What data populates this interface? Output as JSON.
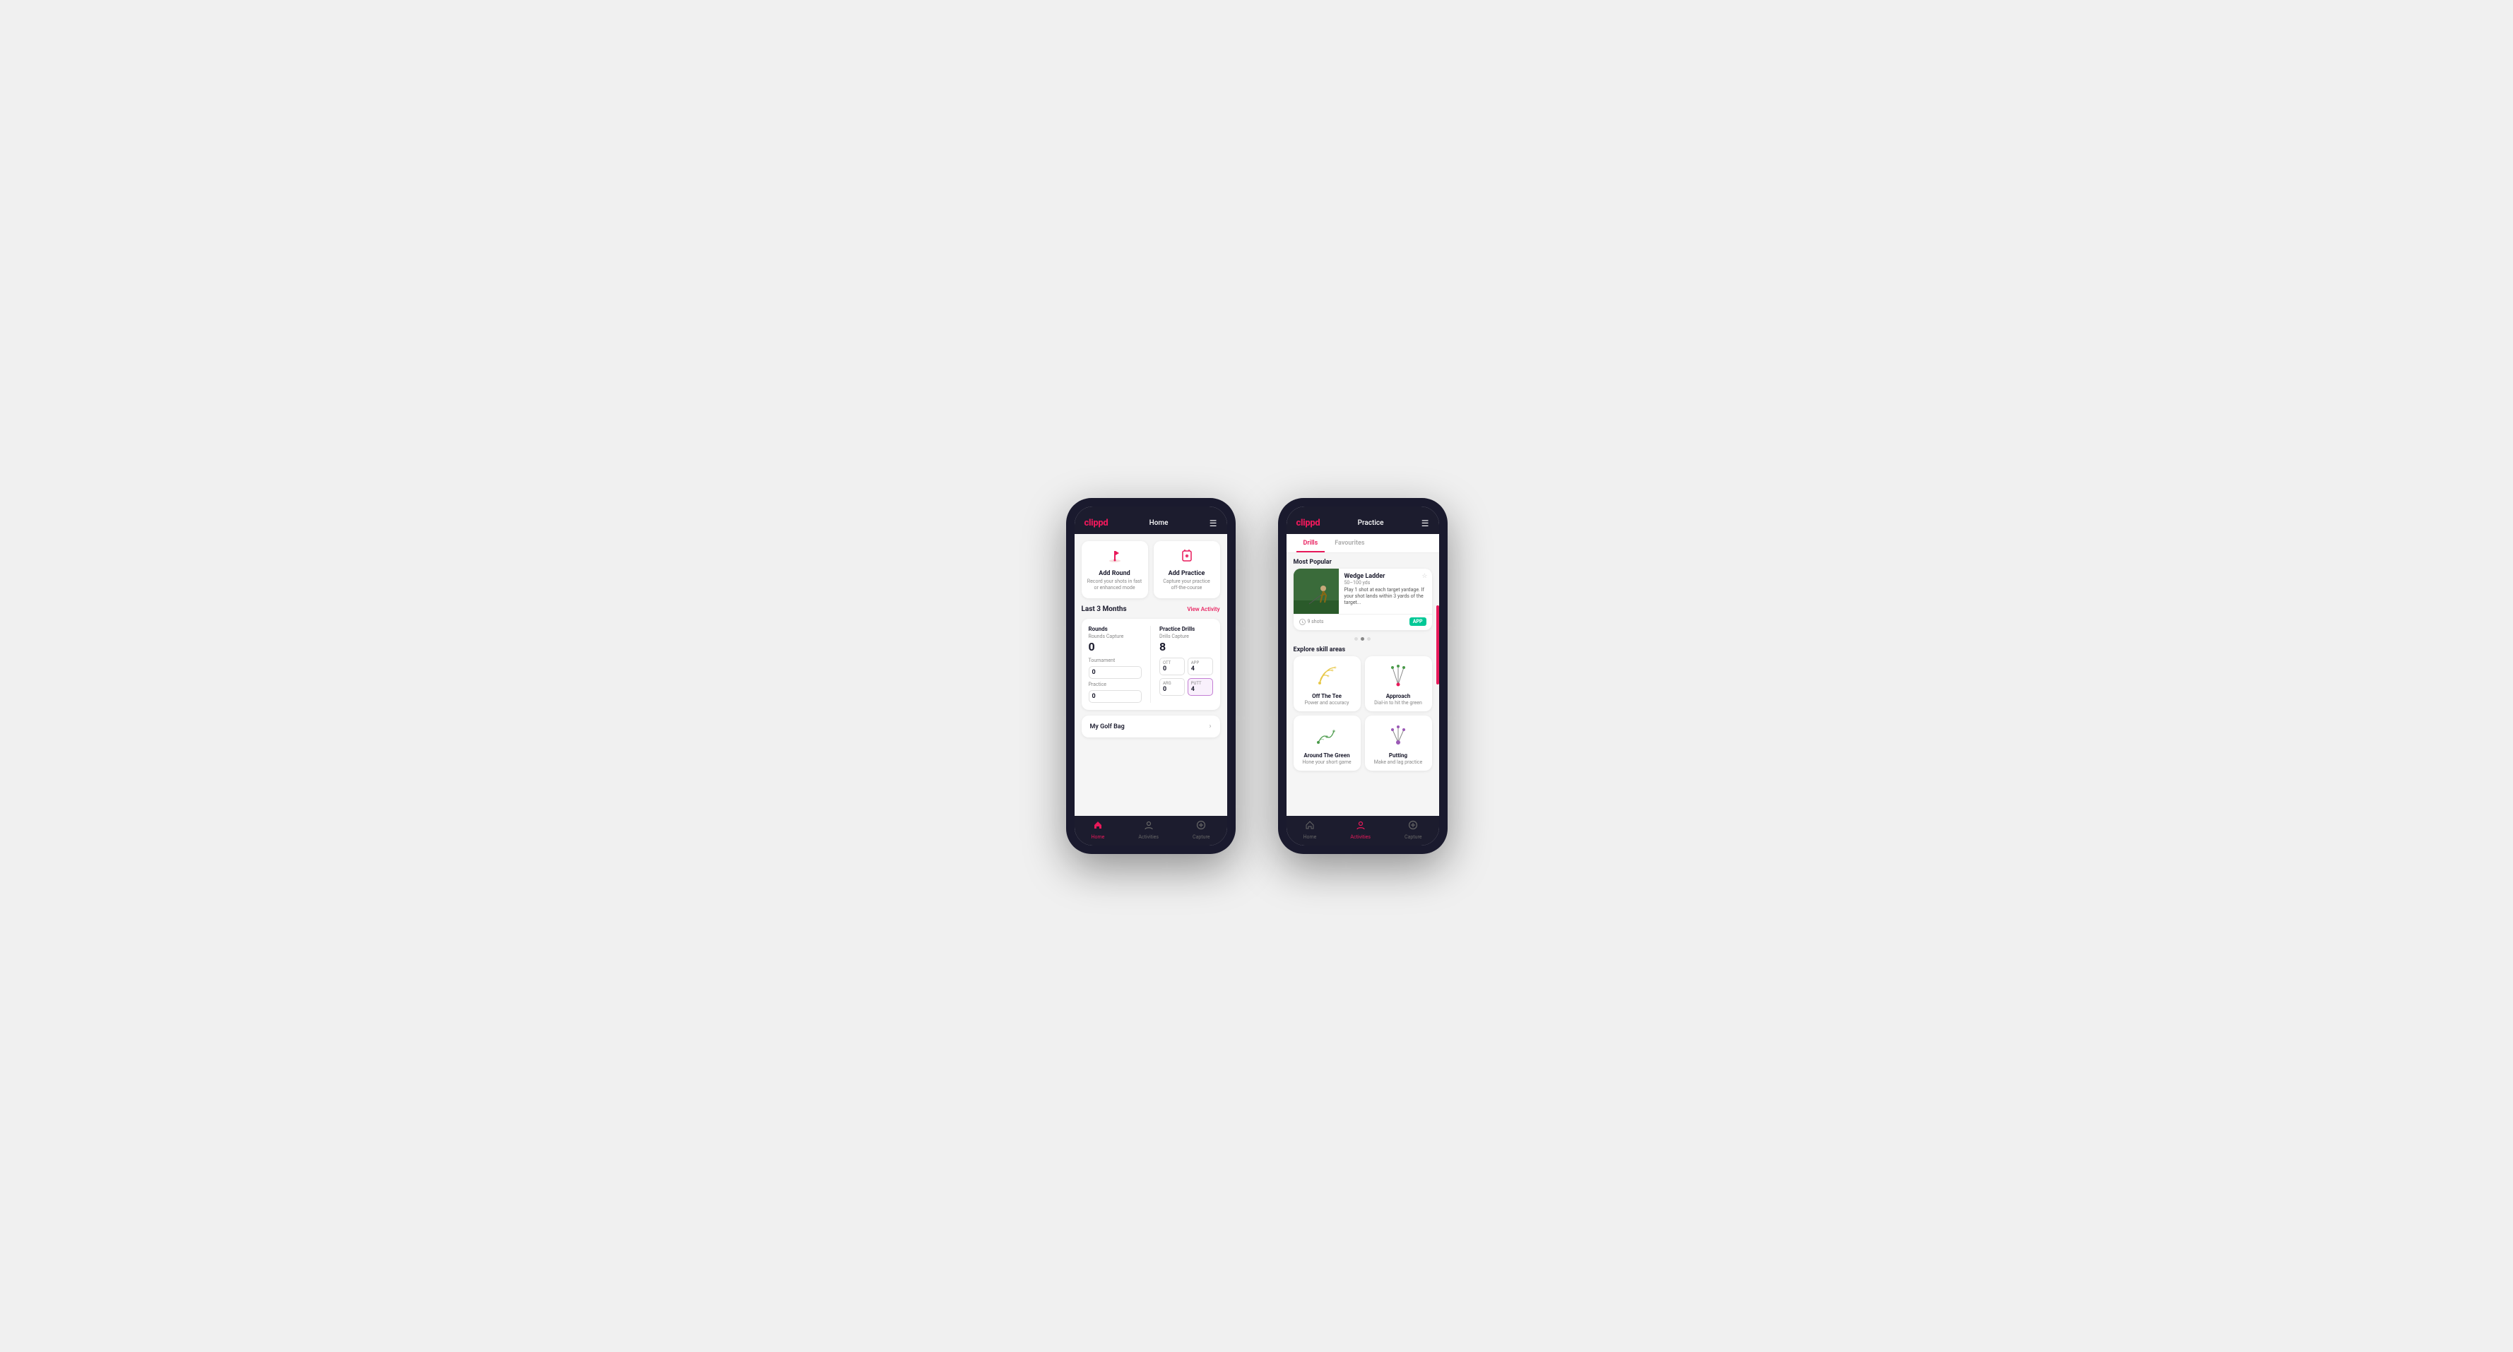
{
  "phone1": {
    "nav": {
      "logo": "clippd",
      "title": "Home",
      "menu": "☰"
    },
    "cards": [
      {
        "id": "add-round",
        "title": "Add Round",
        "desc": "Record your shots in fast or enhanced mode",
        "icon": "flag"
      },
      {
        "id": "add-practice",
        "title": "Add Practice",
        "desc": "Capture your practice off-the-course",
        "icon": "practice"
      }
    ],
    "activity_section": {
      "label": "Last 3 Months",
      "link": "View Activity"
    },
    "rounds": {
      "title": "Rounds",
      "capture_label": "Rounds Capture",
      "capture_value": "0",
      "rows": [
        {
          "label": "Tournament",
          "value": "0"
        },
        {
          "label": "Practice",
          "value": "0"
        }
      ]
    },
    "drills": {
      "title": "Practice Drills",
      "capture_label": "Drills Capture",
      "capture_value": "8",
      "cells": [
        {
          "label": "OTT",
          "value": "0",
          "highlighted": false
        },
        {
          "label": "APP",
          "value": "4",
          "highlighted": false
        },
        {
          "label": "ARG",
          "value": "0",
          "highlighted": false
        },
        {
          "label": "PUTT",
          "value": "4",
          "highlighted": true
        }
      ]
    },
    "golf_bag": "My Golf Bag",
    "bottom_nav": [
      {
        "label": "Home",
        "icon": "🏠",
        "active": true
      },
      {
        "label": "Activities",
        "icon": "⚙",
        "active": false
      },
      {
        "label": "Capture",
        "icon": "➕",
        "active": false
      }
    ]
  },
  "phone2": {
    "nav": {
      "logo": "clippd",
      "title": "Practice",
      "menu": "☰"
    },
    "tabs": [
      {
        "label": "Drills",
        "active": true
      },
      {
        "label": "Favourites",
        "active": false
      }
    ],
    "most_popular_label": "Most Popular",
    "featured": {
      "title": "Wedge Ladder",
      "subtitle": "50–100 yds",
      "desc": "Play 1 shot at each target yardage. If your shot lands within 3 yards of the target...",
      "shots": "9 shots",
      "badge": "APP"
    },
    "dots": [
      {
        "active": false
      },
      {
        "active": true
      },
      {
        "active": false
      }
    ],
    "explore_label": "Explore skill areas",
    "skills": [
      {
        "id": "off-the-tee",
        "title": "Off The Tee",
        "desc": "Power and accuracy",
        "icon": "tee"
      },
      {
        "id": "approach",
        "title": "Approach",
        "desc": "Dial-in to hit the green",
        "icon": "approach"
      },
      {
        "id": "around-the-green",
        "title": "Around The Green",
        "desc": "Hone your short game",
        "icon": "atg"
      },
      {
        "id": "putting",
        "title": "Putting",
        "desc": "Make and lag practice",
        "icon": "putt"
      }
    ],
    "bottom_nav": [
      {
        "label": "Home",
        "icon": "🏠",
        "active": false
      },
      {
        "label": "Activities",
        "icon": "⚙",
        "active": true
      },
      {
        "label": "Capture",
        "icon": "➕",
        "active": false
      }
    ]
  },
  "colors": {
    "brand_pink": "#e8195a",
    "dark_bg": "#1c1c2e",
    "light_bg": "#f5f5f5",
    "white": "#ffffff",
    "app_badge": "#00c896",
    "putt_highlight": "#c47ed4"
  }
}
